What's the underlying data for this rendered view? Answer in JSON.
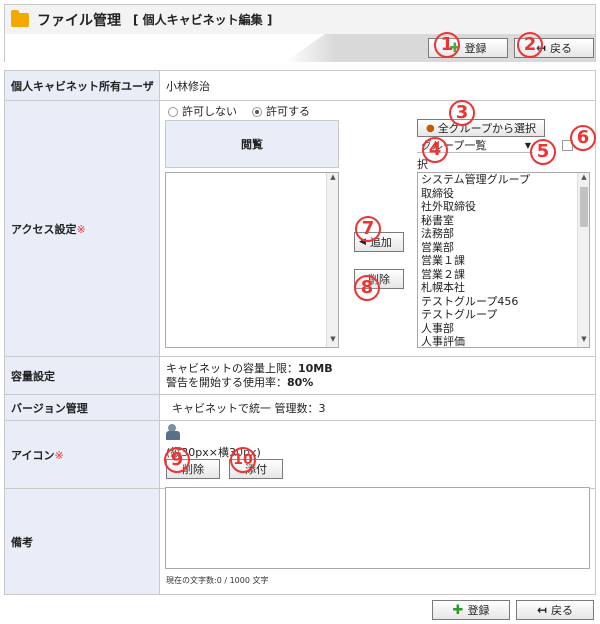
{
  "header": {
    "title": "ファイル管理",
    "subtitle": "[ 個人キャビネット編集 ]"
  },
  "toolbar": {
    "register_label": "登録",
    "back_label": "戻る"
  },
  "markers": [
    "1",
    "2",
    "3",
    "4",
    "5",
    "6",
    "7",
    "8",
    "9",
    "10"
  ],
  "rows": {
    "owner": {
      "label": "個人キャビネット所有ユーザ",
      "value": "小林修治"
    },
    "access": {
      "label": "アクセス設定",
      "required_mark": "※",
      "radio_deny": "許可しない",
      "radio_allow": "許可する",
      "selected": "許可する",
      "view_header": "閲覧",
      "select_all_groups": "全グループから選択",
      "group_dropdown": "グループ一覧",
      "right_label": "択",
      "add_label": "追加",
      "delete_label": "削除",
      "groups": [
        "システム管理グループ",
        "取締役",
        "社外取締役",
        "秘書室",
        "法務部",
        "営業部",
        "営業１課",
        "営業２課",
        "札幌本社",
        "テストグループ456",
        "テストグループ",
        "人事部",
        "人事評価"
      ]
    },
    "capacity": {
      "label": "容量設定",
      "line1_prefix": "キャビネットの容量上限：",
      "line1_value": "10MB",
      "line2_prefix": "警告を開始する使用率：",
      "line2_value": "80%"
    },
    "version": {
      "label": "バージョン管理",
      "value": "キャビネットで統一 管理数：3"
    },
    "icon": {
      "label": "アイコン",
      "required_mark": "※",
      "size_note": "(縦30px×横30px)",
      "delete_label": "削除",
      "attach_label": "添付"
    },
    "notes": {
      "label": "備考",
      "counter": "現在の文字数:0 / 1000 文字"
    }
  }
}
